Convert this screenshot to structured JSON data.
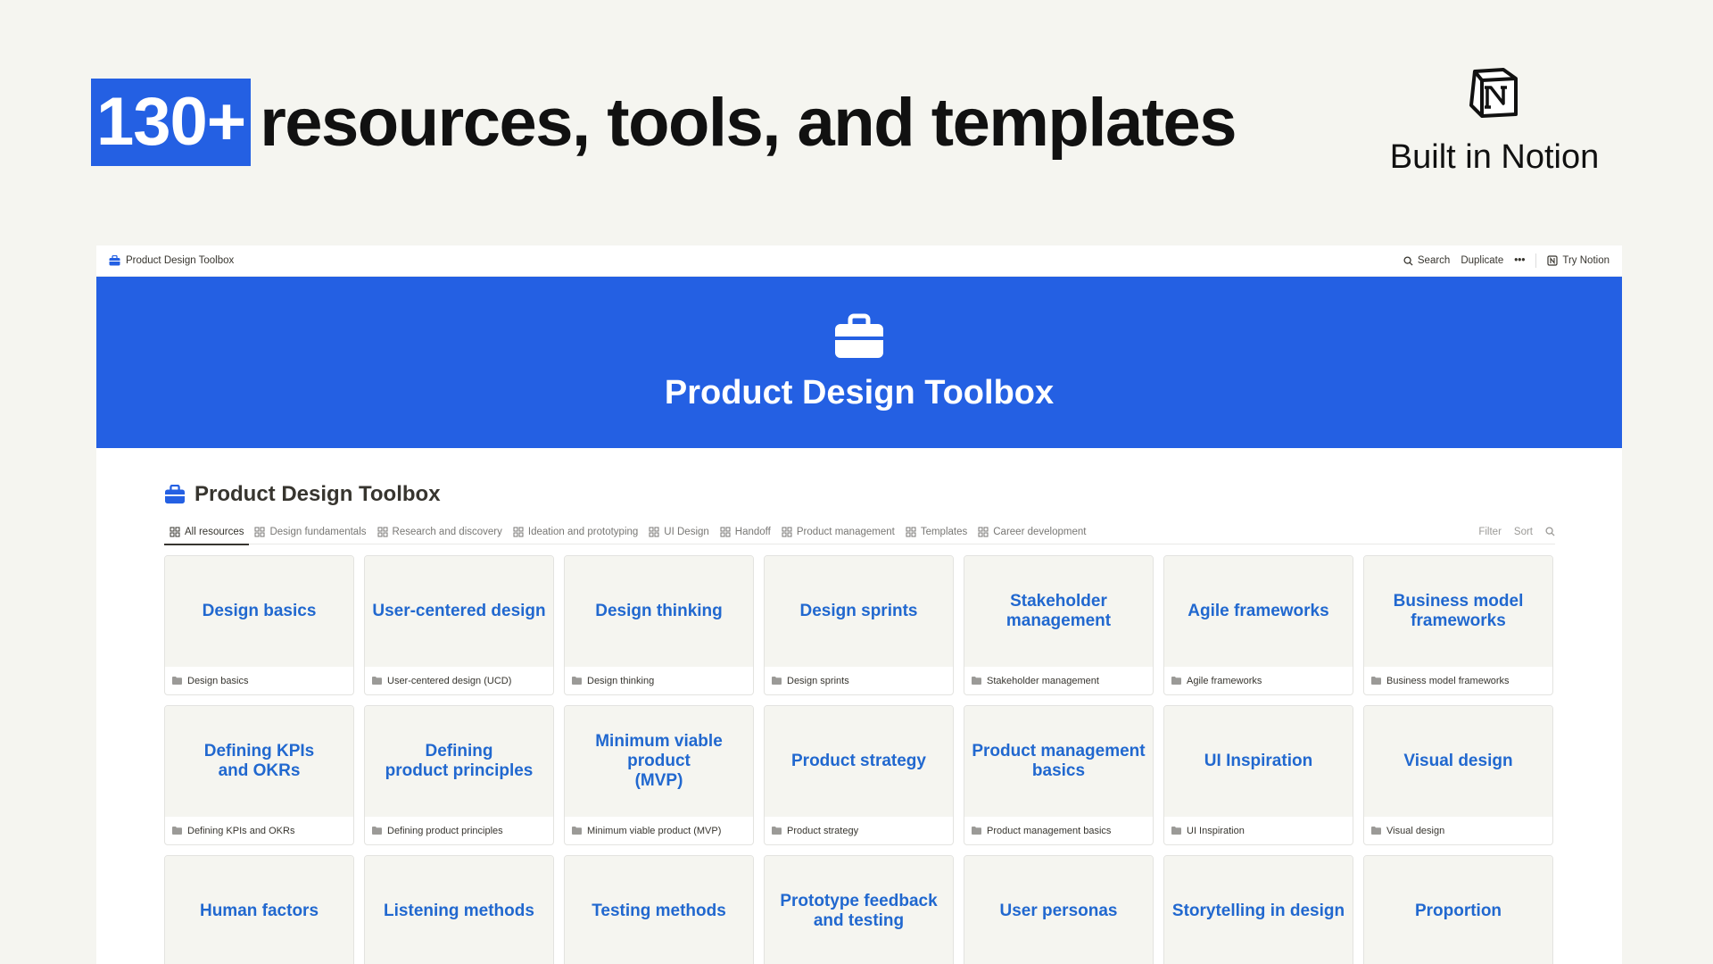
{
  "hero": {
    "highlight": "130+",
    "rest": "resources, tools, and templates"
  },
  "brand": {
    "text": "Built in Notion",
    "icon": "notion-logo-icon"
  },
  "topbar": {
    "page_name": "Product Design Toolbox",
    "search": "Search",
    "duplicate": "Duplicate",
    "more": "•••",
    "try_notion": "Try Notion"
  },
  "cover": {
    "title": "Product Design Toolbox",
    "icon": "briefcase-icon"
  },
  "database": {
    "title": "Product Design Toolbox",
    "tabs": [
      {
        "label": "All resources",
        "active": true
      },
      {
        "label": "Design fundamentals"
      },
      {
        "label": "Research and discovery"
      },
      {
        "label": "Ideation and prototyping"
      },
      {
        "label": "UI Design"
      },
      {
        "label": "Handoff"
      },
      {
        "label": "Product management"
      },
      {
        "label": "Templates"
      },
      {
        "label": "Career development"
      }
    ],
    "tools": {
      "filter": "Filter",
      "sort": "Sort"
    },
    "cards": [
      {
        "title": "Design basics",
        "footer": "Design basics"
      },
      {
        "title": "User-centered design",
        "footer": "User-centered design (UCD)"
      },
      {
        "title": "Design thinking",
        "footer": "Design thinking"
      },
      {
        "title": "Design sprints",
        "footer": "Design sprints"
      },
      {
        "title": "Stakeholder\nmanagement",
        "footer": "Stakeholder management"
      },
      {
        "title": "Agile frameworks",
        "footer": "Agile frameworks"
      },
      {
        "title": "Business model\nframeworks",
        "footer": "Business model frameworks"
      },
      {
        "title": "Defining KPIs\nand OKRs",
        "footer": "Defining KPIs and OKRs"
      },
      {
        "title": "Defining\nproduct principles",
        "footer": "Defining product principles"
      },
      {
        "title": "Minimum viable product\n(MVP)",
        "footer": "Minimum viable product (MVP)"
      },
      {
        "title": "Product strategy",
        "footer": "Product strategy"
      },
      {
        "title": "Product management\nbasics",
        "footer": "Product management basics"
      },
      {
        "title": "UI Inspiration",
        "footer": "UI Inspiration"
      },
      {
        "title": "Visual design",
        "footer": "Visual design"
      },
      {
        "title": "Human factors",
        "footer": ""
      },
      {
        "title": "Listening methods",
        "footer": ""
      },
      {
        "title": "Testing methods",
        "footer": ""
      },
      {
        "title": "Prototype feedback\nand testing",
        "footer": ""
      },
      {
        "title": "User personas",
        "footer": ""
      },
      {
        "title": "Storytelling in design",
        "footer": ""
      },
      {
        "title": "Proportion",
        "footer": ""
      }
    ]
  },
  "colors": {
    "accent": "#2460e3",
    "card_title": "#2168cf",
    "canvas": "#f5f5f0"
  }
}
